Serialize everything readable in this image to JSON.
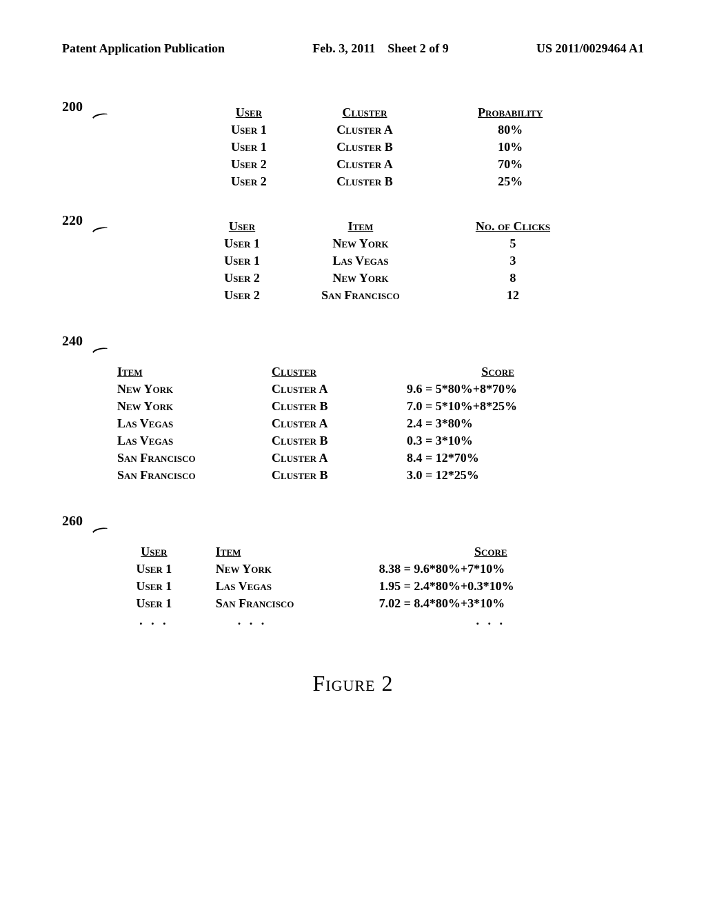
{
  "header": {
    "left": "Patent Application Publication",
    "center_date": "Feb. 3, 2011",
    "center_sheet": "Sheet 2 of 9",
    "right": "US 2011/0029464 A1"
  },
  "sections": {
    "s200": {
      "ref": "200",
      "headers": [
        "User",
        "Cluster",
        "Probability"
      ],
      "rows": [
        [
          "User 1",
          "Cluster A",
          "80%"
        ],
        [
          "User 1",
          "Cluster B",
          "10%"
        ],
        [
          "User 2",
          "Cluster A",
          "70%"
        ],
        [
          "User 2",
          "Cluster B",
          "25%"
        ]
      ]
    },
    "s220": {
      "ref": "220",
      "headers": [
        "User",
        "Item",
        "No. of Clicks"
      ],
      "rows": [
        [
          "User 1",
          "New York",
          "5"
        ],
        [
          "User 1",
          "Las Vegas",
          "3"
        ],
        [
          "User 2",
          "New York",
          "8"
        ],
        [
          "User 2",
          "San Francisco",
          "12"
        ]
      ]
    },
    "s240": {
      "ref": "240",
      "headers": [
        "Item",
        "Cluster",
        "Score"
      ],
      "rows": [
        [
          "New York",
          "Cluster A",
          "9.6 = 5*80%+8*70%"
        ],
        [
          "New York",
          "Cluster B",
          "7.0 = 5*10%+8*25%"
        ],
        [
          "Las Vegas",
          "Cluster A",
          "2.4 = 3*80%"
        ],
        [
          "Las Vegas",
          "Cluster B",
          "0.3 = 3*10%"
        ],
        [
          "San Francisco",
          "Cluster A",
          "8.4 = 12*70%"
        ],
        [
          "San Francisco",
          "Cluster B",
          "3.0 = 12*25%"
        ]
      ]
    },
    "s260": {
      "ref": "260",
      "headers": [
        "User",
        "Item",
        "Score"
      ],
      "rows": [
        [
          "User 1",
          "New York",
          "8.38 = 9.6*80%+7*10%"
        ],
        [
          "User 1",
          "Las Vegas",
          "1.95 = 2.4*80%+0.3*10%"
        ],
        [
          "User 1",
          "San Francisco",
          "7.02 = 8.4*80%+3*10%"
        ]
      ],
      "ellipsis": ". . .",
      "ellipsis2": ". . .",
      "ellipsis3": ". . ."
    }
  },
  "caption": "Figure 2"
}
